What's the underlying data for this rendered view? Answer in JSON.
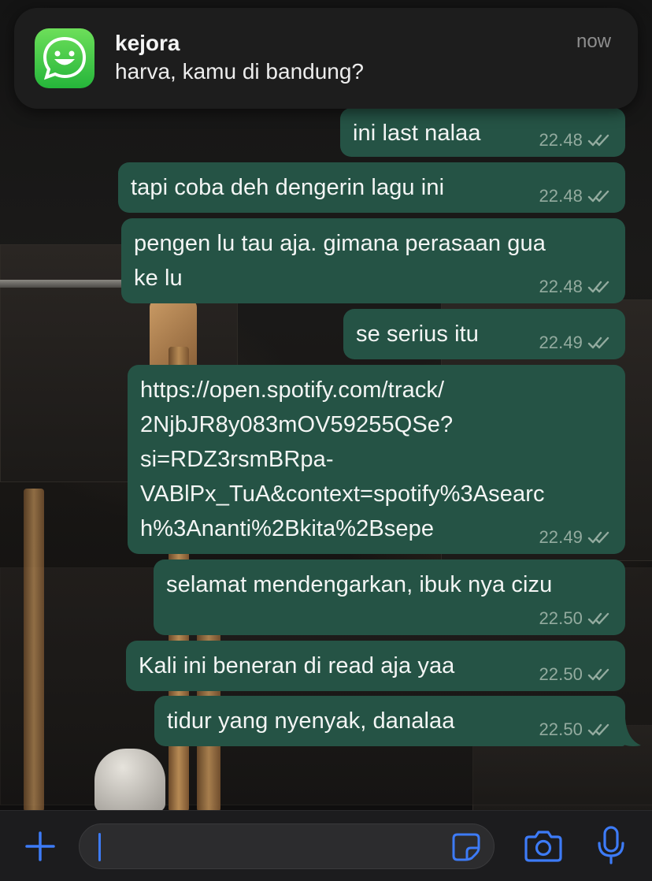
{
  "notification": {
    "app_icon": "whatsapp-style-smiley-icon",
    "sender": "kejora",
    "message": "harva, kamu di bandung?",
    "time": "now"
  },
  "messages": [
    {
      "text": "ini last nalaa",
      "time": "22.48",
      "status": "read",
      "ticks_icon": "double-check-icon"
    },
    {
      "text": "tapi coba deh dengerin lagu ini",
      "time": "22.48",
      "status": "read",
      "ticks_icon": "double-check-icon"
    },
    {
      "text": "pengen lu tau aja. gimana perasaan gua\nke lu",
      "time": "22.48",
      "status": "read",
      "ticks_icon": "double-check-icon"
    },
    {
      "text": "se serius itu",
      "time": "22.49",
      "status": "read",
      "ticks_icon": "double-check-icon"
    },
    {
      "text": "https://open.spotify.com/track/\n2NjbJR8y083mOV59255QSe?\nsi=RDZ3rsmBRpa-\nVABlPx_TuA&context=spotify%3Asearc\nh%3Ananti%2Bkita%2Bsepe",
      "time": "22.49",
      "status": "read",
      "ticks_icon": "double-check-icon"
    },
    {
      "text": "selamat mendengarkan, ibuk nya cizu",
      "time": "22.50",
      "status": "read",
      "ticks_icon": "double-check-icon"
    },
    {
      "text": "Kali ini beneran di read aja yaa",
      "time": "22.50",
      "status": "read",
      "ticks_icon": "double-check-icon"
    },
    {
      "text": "tidur yang nyenyak, danalaa",
      "time": "22.50",
      "status": "read",
      "ticks_icon": "double-check-icon"
    }
  ],
  "input_bar": {
    "attach_icon": "plus-icon",
    "input_value": "",
    "input_placeholder": "",
    "sticker_icon": "sticker-icon",
    "camera_icon": "camera-icon",
    "mic_icon": "microphone-icon"
  },
  "colors": {
    "outgoing_bubble": "#255345",
    "meta_text": "#93ab9f",
    "accent_blue": "#3d7bf7",
    "notification_bg": "#1e1e1e",
    "app_icon_green": "#25b53a"
  }
}
